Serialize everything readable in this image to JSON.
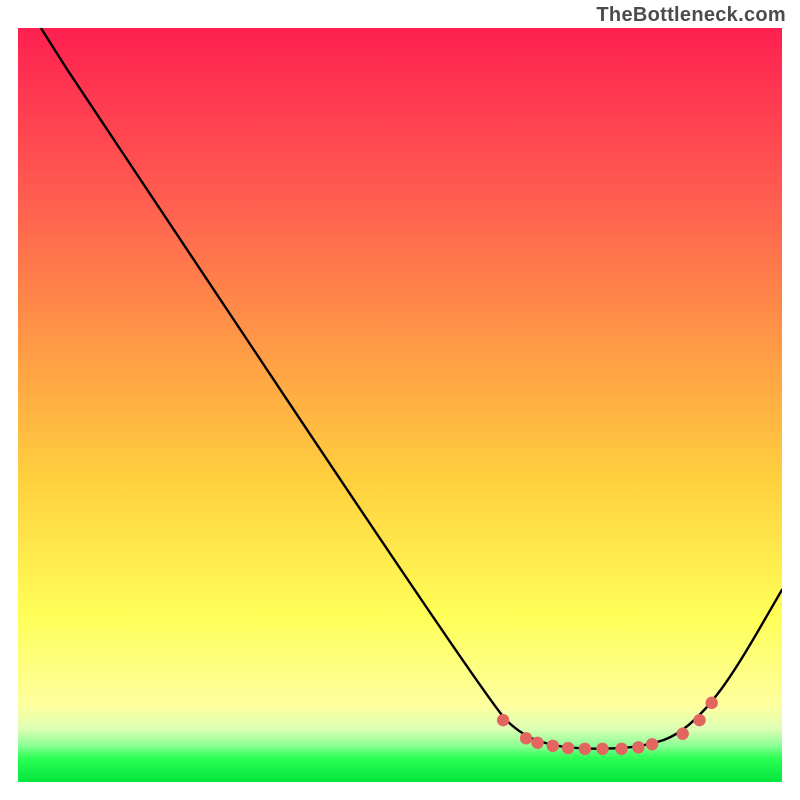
{
  "watermark": "TheBottleneck.com",
  "chart_data": {
    "type": "line",
    "title": "",
    "xlabel": "",
    "ylabel": "",
    "xlim": [
      0,
      100
    ],
    "ylim": [
      0,
      100
    ],
    "grid": false,
    "legend": false,
    "gradient_colors": {
      "top": "#fe2050",
      "mid_upper": "#ff7f50",
      "mid": "#ffd040",
      "mid_lower": "#ffff60",
      "green_band": "#2bff55",
      "bottom": "#02e53c"
    },
    "description": "Black V-shaped curve over vertical red-to-yellow-to-green gradient. Descends from upper-left, reaches minimum around x≈78 where a short flat segment is highlighted with coral dots, then rises toward the right edge.",
    "curve_points_normalized_svg": [
      {
        "x": 0.03,
        "y": 0.0
      },
      {
        "x": 0.055,
        "y": 0.04
      },
      {
        "x": 0.075,
        "y": 0.072
      },
      {
        "x": 0.62,
        "y": 0.9
      },
      {
        "x": 0.66,
        "y": 0.938
      },
      {
        "x": 0.7,
        "y": 0.952
      },
      {
        "x": 0.74,
        "y": 0.956
      },
      {
        "x": 0.78,
        "y": 0.956
      },
      {
        "x": 0.82,
        "y": 0.952
      },
      {
        "x": 0.86,
        "y": 0.94
      },
      {
        "x": 0.9,
        "y": 0.905
      },
      {
        "x": 0.94,
        "y": 0.85
      },
      {
        "x": 1.0,
        "y": 0.745
      }
    ],
    "marker_points_normalized_svg": [
      {
        "x": 0.635,
        "y": 0.918
      },
      {
        "x": 0.665,
        "y": 0.942
      },
      {
        "x": 0.68,
        "y": 0.948
      },
      {
        "x": 0.7,
        "y": 0.952
      },
      {
        "x": 0.72,
        "y": 0.955
      },
      {
        "x": 0.742,
        "y": 0.956
      },
      {
        "x": 0.765,
        "y": 0.956
      },
      {
        "x": 0.79,
        "y": 0.956
      },
      {
        "x": 0.812,
        "y": 0.954
      },
      {
        "x": 0.83,
        "y": 0.95
      },
      {
        "x": 0.87,
        "y": 0.936
      },
      {
        "x": 0.892,
        "y": 0.918
      },
      {
        "x": 0.908,
        "y": 0.895
      }
    ],
    "marker_color": "#e2655f",
    "curve_color": "#000000"
  }
}
